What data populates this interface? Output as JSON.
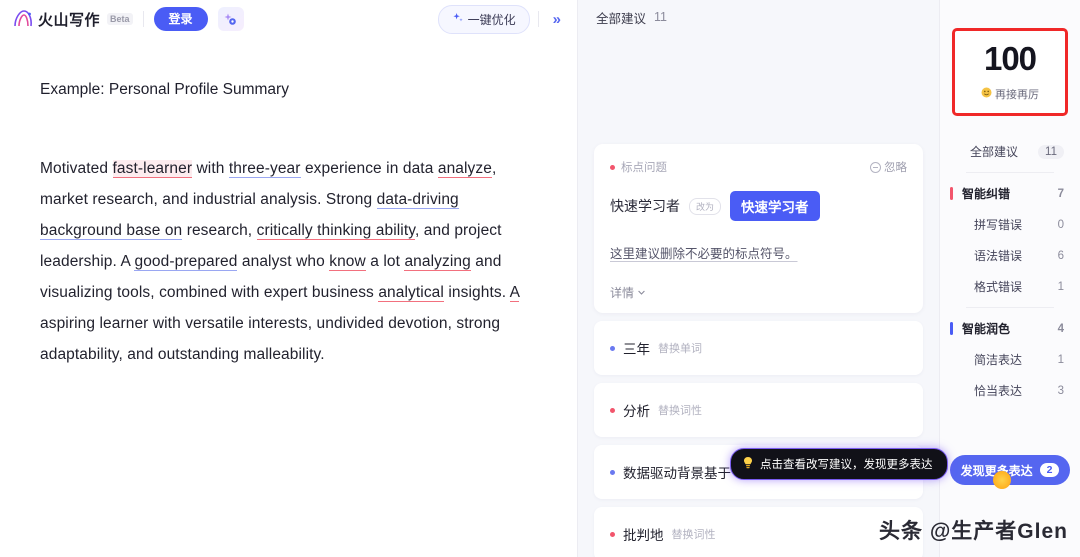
{
  "topbar": {
    "brand_name": "火山写作",
    "beta_badge": "Beta",
    "login_label": "登录",
    "ai_icon": "sparkle-ai-icon",
    "optimize_label": "一键优化",
    "optimize_icon": "sparkle-icon",
    "collapse_icon": "»"
  },
  "document": {
    "title": "Example: Personal Profile Summary",
    "paragraph_parts": [
      {
        "text": "Motivated ",
        "style": "plain"
      },
      {
        "text": "fast-learner",
        "style": "error-highlight"
      },
      {
        "text": " with ",
        "style": "plain"
      },
      {
        "text": "three-year",
        "style": "blue-underline"
      },
      {
        "text": " experience in data ",
        "style": "plain"
      },
      {
        "text": "analyze",
        "style": "red-underline"
      },
      {
        "text": ", market research, and industrial analysis. Strong ",
        "style": "plain"
      },
      {
        "text": "data-driving background base on",
        "style": "blue-underline"
      },
      {
        "text": " research, ",
        "style": "plain"
      },
      {
        "text": "critically thinking ability",
        "style": "red-underline"
      },
      {
        "text": ", and project leadership. A ",
        "style": "plain"
      },
      {
        "text": "good-prepared",
        "style": "blue-underline"
      },
      {
        "text": " analyst who ",
        "style": "plain"
      },
      {
        "text": "know",
        "style": "red-underline"
      },
      {
        "text": " a lot ",
        "style": "plain"
      },
      {
        "text": "analyzing",
        "style": "red-underline"
      },
      {
        "text": " and visualizing tools, combined with expert business ",
        "style": "plain"
      },
      {
        "text": "analytical",
        "style": "red-underline"
      },
      {
        "text": " insights. ",
        "style": "plain"
      },
      {
        "text": "A",
        "style": "red-underline"
      },
      {
        "text": " aspiring learner with versatile interests, undivided devotion, strong adaptability, and outstanding malleability.",
        "style": "plain"
      }
    ]
  },
  "suggestions_panel": {
    "header_label": "全部建议",
    "header_count": "11",
    "card": {
      "tag_label": "标点问题",
      "tag_dot_color": "#f2556c",
      "ignore_label": "忽略",
      "ignore_icon": "minus-circle-icon",
      "original_text": "快速学习者",
      "change_pill_label": "改为",
      "replacement_text": "快速学习者",
      "description": "这里建议删除不必要的标点符号。",
      "detail_label": "详情",
      "detail_icon": "chevron-down-icon"
    },
    "items": [
      {
        "word": "三年",
        "action": "替换单词",
        "dot_color": "#6a79f0"
      },
      {
        "word": "分析",
        "action": "替换词性",
        "dot_color": "#f2556c"
      },
      {
        "word": "数据驱动背景基于",
        "action": "替换",
        "dot_color": "#6a79f0"
      },
      {
        "word": "批判地",
        "action": "替换词性",
        "dot_color": "#f2556c"
      }
    ],
    "tooltip": {
      "icon": "lightbulb-icon",
      "text": "点击查看改写建议，发现更多表达"
    }
  },
  "score_panel": {
    "score": "100",
    "score_caption": "再接再厉",
    "score_caption_icon": "smile-emoji",
    "highlight_border_color": "#f02828",
    "nav": [
      {
        "label": "全部建议",
        "count": "11",
        "level": "all",
        "bar_color": ""
      },
      {
        "label": "智能纠错",
        "count": "7",
        "level": "group",
        "bar_color": "#f2556c"
      },
      {
        "label": "拼写错误",
        "count": "0",
        "level": "sub",
        "bar_color": ""
      },
      {
        "label": "语法错误",
        "count": "6",
        "level": "sub",
        "bar_color": ""
      },
      {
        "label": "格式错误",
        "count": "1",
        "level": "sub",
        "bar_color": ""
      },
      {
        "label": "智能润色",
        "count": "4",
        "level": "group",
        "bar_color": "#4a5cf5"
      },
      {
        "label": "简洁表达",
        "count": "1",
        "level": "sub",
        "bar_color": ""
      },
      {
        "label": "恰当表达",
        "count": "3",
        "level": "sub",
        "bar_color": ""
      }
    ],
    "more_button_label": "发现更多表达",
    "more_button_badge": "2"
  },
  "watermark": "头条 @生产者Glen"
}
